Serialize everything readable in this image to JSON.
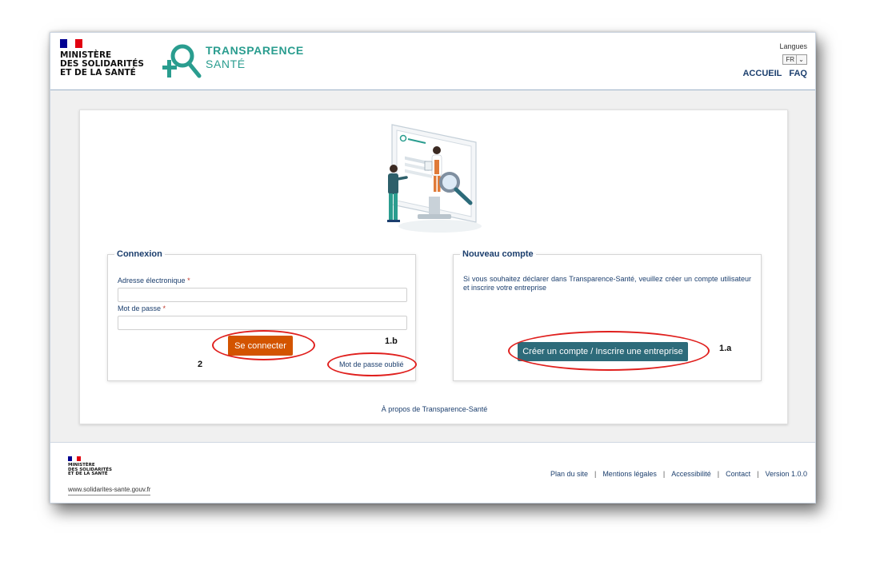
{
  "colors": {
    "brand_teal": "#2a9d8f",
    "navy": "#1c3f6e",
    "login_button": "#d35400",
    "create_button": "#2d6b7a",
    "annotation_ring": "#e0201e"
  },
  "header": {
    "ministry_logo": {
      "lines": [
        "MINISTÈRE",
        "DES SOLIDARITÉS",
        "ET DE LA SANTÉ"
      ]
    },
    "app_logo": {
      "line1": "TRANSPARENCE",
      "line2": "SANTÉ"
    },
    "language": {
      "label": "Langues",
      "selected": "FR",
      "icon": "chevron-down-icon"
    },
    "nav": {
      "home": "ACCUEIL",
      "faq": "FAQ"
    }
  },
  "login": {
    "legend": "Connexion",
    "email_label": "Adresse électronique",
    "password_label": "Mot de passe",
    "required_mark": "*",
    "email_value": "",
    "password_value": "",
    "submit_label": "Se connecter",
    "forgot_label": "Mot de passe oublié"
  },
  "new_account": {
    "legend": "Nouveau compte",
    "text": "Si vous souhaitez déclarer dans Transparence-Santé, veuillez créer un compte utilisateur et inscrire votre entreprise",
    "button_label": "Créer un compte / Inscrire une entreprise"
  },
  "annotations": {
    "step_2": "2",
    "step_1b": "1.b",
    "step_1a": "1.a"
  },
  "about_link": "À propos de Transparence-Santé",
  "footer": {
    "ministry_logo": {
      "lines": [
        "MINISTÈRE",
        "DES SOLIDARITÉS",
        "ET DE LA SANTÉ"
      ]
    },
    "site_url": "www.solidarites-sante.gouv.fr",
    "links": [
      "Plan du site",
      "Mentions légales",
      "Accessibilité",
      "Contact"
    ],
    "version": "Version 1.0.0"
  }
}
